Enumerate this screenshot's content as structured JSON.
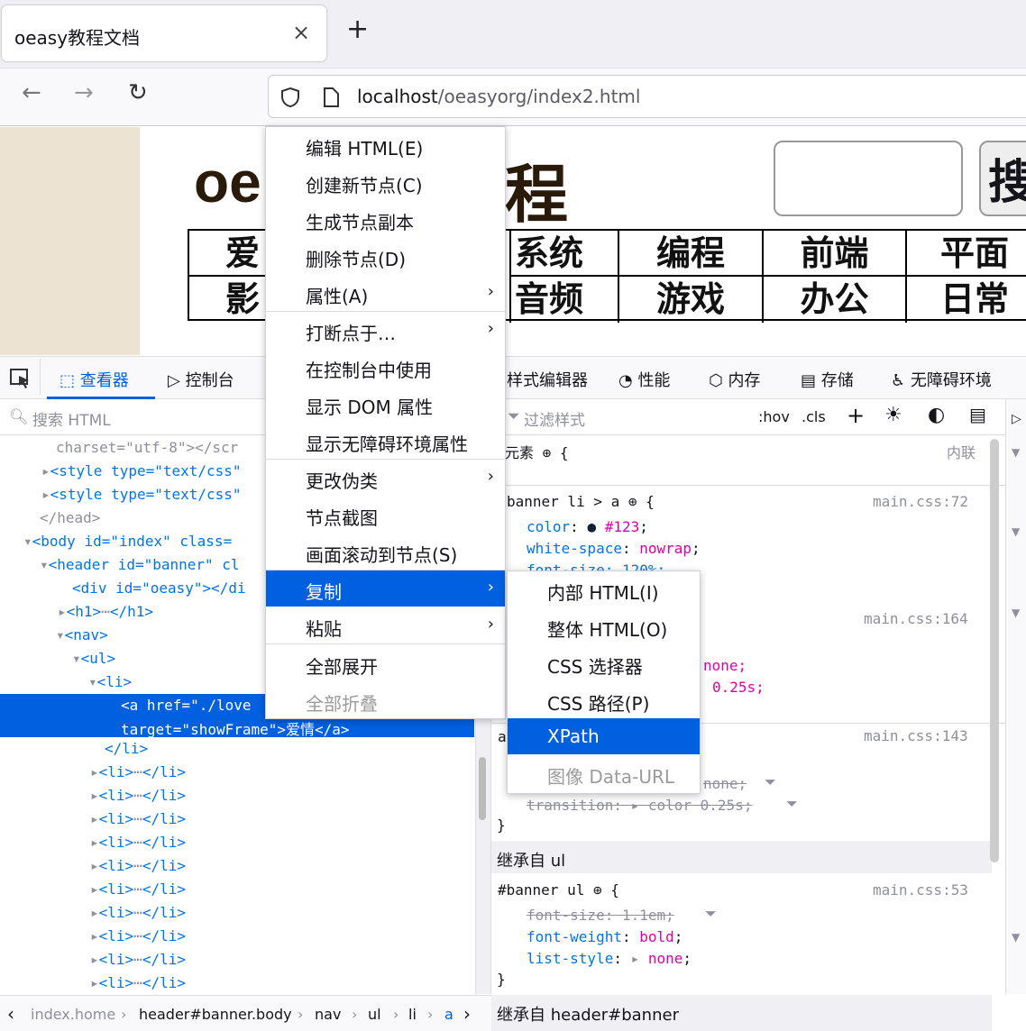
{
  "tab": {
    "title": "oeasy教程文档",
    "close": "×",
    "new": "+"
  },
  "nav": {
    "back": "←",
    "forward": "→",
    "reload": "↻",
    "url_host": "localhost",
    "url_path": "/oeasyorg/index2.html"
  },
  "page": {
    "logo_left": "oe",
    "logo_right": "程",
    "search_btn": "搜",
    "row1": [
      "爱",
      "系统",
      "编程",
      "前端",
      "平面"
    ],
    "row2": [
      "影",
      "音频",
      "游戏",
      "办公",
      "日常"
    ]
  },
  "devtools": {
    "tabs": {
      "inspector": "查看器",
      "console": "控制台",
      "style_editor": "样式编辑器",
      "performance": "性能",
      "memory": "内存",
      "storage": "存储",
      "accessibility": "无障碍环境"
    },
    "search_html": "搜索 HTML",
    "filter_styles": "过滤样式",
    "hov": ":hov",
    "cls": ".cls",
    "tree": [
      {
        "t": "charset=\"utf-8\"></scr"
      },
      {
        "t": "<style type=\"text/css\""
      },
      {
        "t": "<style type=\"text/css\""
      },
      {
        "t": "</head>"
      },
      {
        "t": "<body id=\"index\" class="
      },
      {
        "t": "<header id=\"banner\" cl"
      },
      {
        "t": "<div id=\"oeasy\"></di"
      },
      {
        "t": "<h1>"
      },
      {
        "t": "<nav>"
      },
      {
        "t": "<ul>"
      },
      {
        "t": "<li>"
      },
      {
        "t": "<a href=\"./love"
      },
      {
        "t": "target=\"showFrame\">爱情</a>"
      },
      {
        "t": "</li>"
      },
      {
        "t": "<li>"
      }
    ],
    "rules": {
      "element": "元素 ⊕ {",
      "inline": "内联",
      "r1_sel": "banner li > a ⊕ {",
      "r1_src": "main.css:72",
      "r1_color": "#123",
      "r1_ws": "nowrap",
      "r1_fs": "font-size: 120%;",
      "r2_src": "main.css:164",
      "r2_none": "none;",
      "r2_025": "0.25s;",
      "r3_sel": "a",
      "r3_src": "main.css:143",
      "r3_strike1": "none;",
      "r3_strike2": "transition: ▸ color 0.25s;",
      "inh_ul": "继承自 ul",
      "r4_sel": "#banner ul ⊕ {",
      "r4_src": "main.css:53",
      "r4_strike": "font-size: 1.1em;",
      "r4_fw": "bold",
      "r4_ls": "none",
      "inh_header": "继承自 header#banner"
    },
    "breadcrumb": [
      "index.home",
      "header#banner.body",
      "nav",
      "ul",
      "li",
      "a"
    ]
  },
  "context_menu": [
    {
      "label": "编辑 HTML(E)"
    },
    {
      "label": "创建新节点(C)"
    },
    {
      "label": "生成节点副本"
    },
    {
      "label": "删除节点(D)"
    },
    {
      "label": "属性(A)",
      "sub": true
    },
    {
      "label": "打断点于…",
      "sub": true
    },
    {
      "label": "在控制台中使用"
    },
    {
      "label": "显示 DOM 属性"
    },
    {
      "label": "显示无障碍环境属性"
    },
    {
      "label": "更改伪类",
      "sub": true
    },
    {
      "label": "节点截图"
    },
    {
      "label": "画面滚动到节点(S)"
    },
    {
      "label": "复制",
      "sub": true,
      "highlighted": true
    },
    {
      "label": "粘贴",
      "sub": true
    },
    {
      "label": "全部展开"
    },
    {
      "label": "全部折叠",
      "disabled": true
    }
  ],
  "copy_submenu": [
    {
      "label": "内部 HTML(I)"
    },
    {
      "label": "整体 HTML(O)"
    },
    {
      "label": "CSS 选择器"
    },
    {
      "label": "CSS 路径(P)"
    },
    {
      "label": "XPath",
      "highlighted": true
    },
    {
      "label": "图像 Data-URL",
      "disabled": true
    }
  ]
}
